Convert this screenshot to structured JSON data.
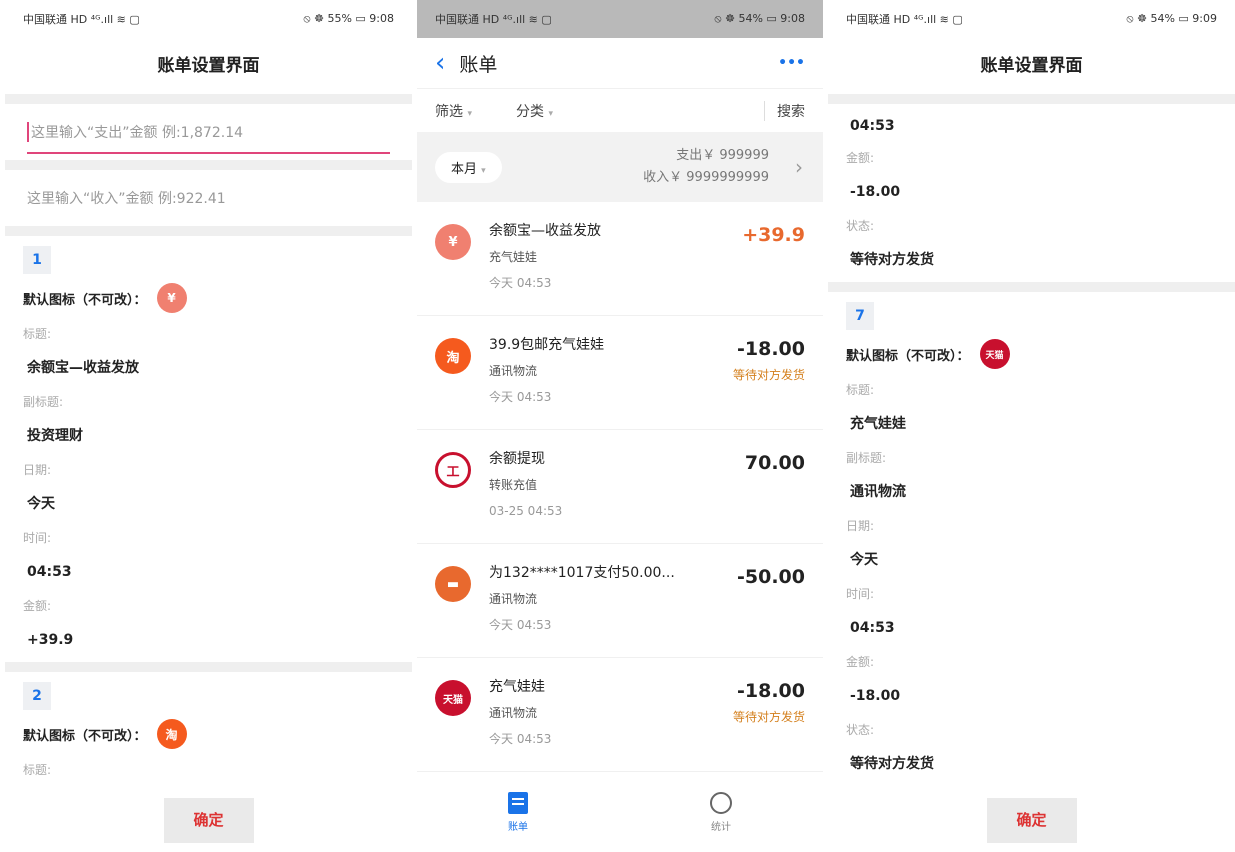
{
  "settings_left": {
    "status": {
      "left": "中国联通 HD ⁴ᴳ.ıll ≋ ▢",
      "right": "⦸ ☸ 55% ▭ 9:08"
    },
    "title": "账单设置界面",
    "expense_placeholder": "这里输入“支出”金额 例:1,872.14",
    "income_placeholder": "这里输入“收入”金额 例:922.41",
    "items": [
      {
        "index": "1",
        "icon_label": "默认图标（不可改）：",
        "title_label": "标题:",
        "title": "余额宝—收益发放",
        "subtitle_label": "副标题:",
        "subtitle": "投资理财",
        "date_label": "日期:",
        "date": "今天",
        "time_label": "时间:",
        "time": "04:53",
        "amount_label": "金额:",
        "amount": "+39.9"
      },
      {
        "index": "2",
        "icon_label": "默认图标（不可改）：",
        "title_label": "标题:"
      }
    ],
    "confirm": "确定"
  },
  "bill": {
    "status": {
      "left": "中国联通 HD ⁴ᴳ.ıll ≋ ▢",
      "right": "⦸ ☸ 54% ▭ 9:08"
    },
    "back": "‹",
    "title": "账单",
    "more": "•••",
    "filter": "筛选",
    "category": "分类",
    "search": "搜索",
    "month": "本月",
    "expense": "支出￥ 999999",
    "income": "收入￥ 9999999999",
    "items": [
      {
        "title": "余额宝—收益发放",
        "sub": "充气娃娃",
        "time": "今天  04:53",
        "amount": "+39.9",
        "status": "",
        "icon": "money-bag-icon",
        "color": "#f08070"
      },
      {
        "title": "39.9包邮充气娃娃",
        "sub": "通讯物流",
        "time": "今天  04:53",
        "amount": "-18.00",
        "status": "等待对方发货",
        "icon": "taobao-icon",
        "color": "#f55a1e"
      },
      {
        "title": "余额提现",
        "sub": "转账充值",
        "time": "03-25  04:53",
        "amount": "70.00",
        "status": "",
        "icon": "bank-icon",
        "color": "#c8102e"
      },
      {
        "title": "为132****1017支付50.00...",
        "sub": "通讯物流",
        "time": "今天  04:53",
        "amount": "-50.00",
        "status": "",
        "icon": "shop-icon",
        "color": "#e8692e"
      },
      {
        "title": "充气娃娃",
        "sub": "通讯物流",
        "time": "今天  04:53",
        "amount": "-18.00",
        "status": "等待对方发货",
        "icon": "tmall-icon",
        "color": "#c8102e"
      }
    ],
    "tab_bill": "账单",
    "tab_stats": "统计"
  },
  "settings_right": {
    "status": {
      "left": "中国联通 HD ⁴ᴳ.ıll ≋ ▢",
      "right": "⦸ ☸ 54% ▭ 9:09"
    },
    "title": "账单设置界面",
    "prev": {
      "time": "04:53",
      "amount_label": "金额:",
      "amount": "-18.00",
      "status_label": "状态:",
      "status": "等待对方发货"
    },
    "item": {
      "index": "7",
      "icon_label": "默认图标（不可改）：",
      "title_label": "标题:",
      "title": "充气娃娃",
      "subtitle_label": "副标题:",
      "subtitle": "通讯物流",
      "date_label": "日期:",
      "date": "今天",
      "time_label": "时间:",
      "time": "04:53",
      "amount_label": "金额:",
      "amount": "-18.00",
      "status_label": "状态:",
      "status": "等待对方发货"
    },
    "confirm": "确定"
  }
}
